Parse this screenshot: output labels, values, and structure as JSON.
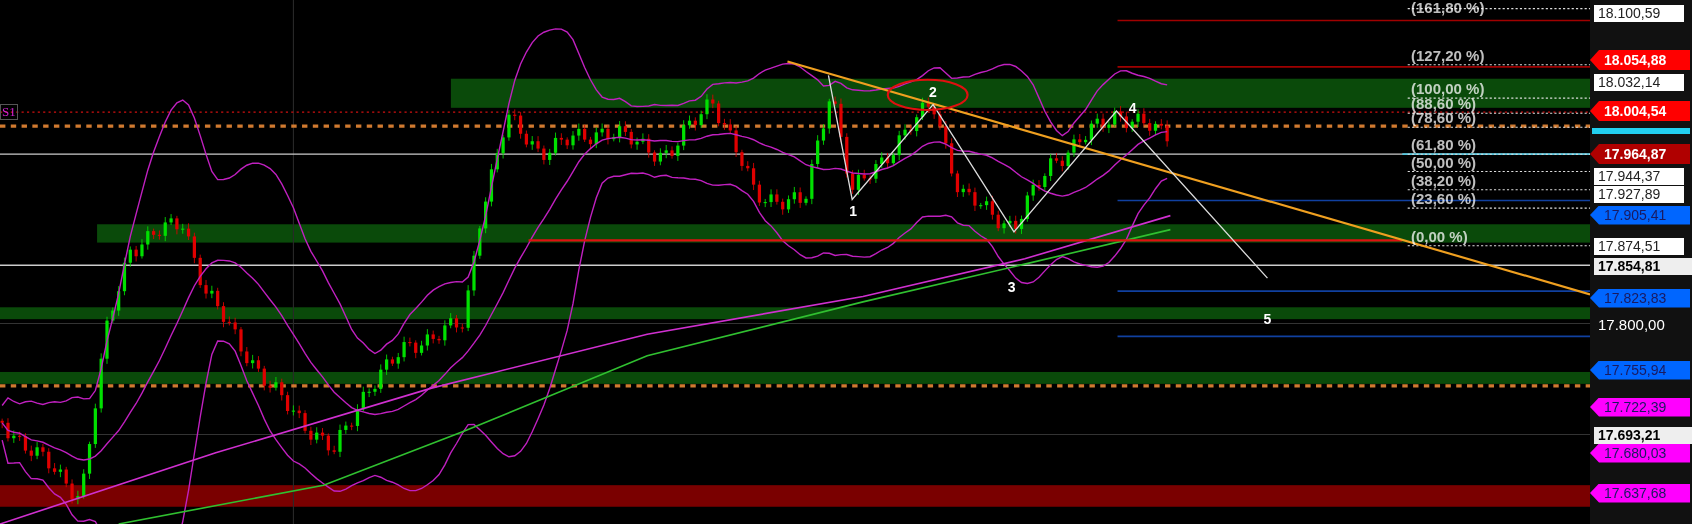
{
  "indicator_label": {
    "text": "S1"
  },
  "fib_levels": [
    {
      "label": "(161,80 %)"
    },
    {
      "label": "(127,20 %)"
    },
    {
      "label": "(100,00 %)"
    },
    {
      "label": "(88,60 %)"
    },
    {
      "label": "(78,60 %)"
    },
    {
      "label": "(61,80 %)"
    },
    {
      "label": "(50,00 %)"
    },
    {
      "label": "(38,20 %)"
    },
    {
      "label": "(23,60 %)"
    },
    {
      "label": "(0,00 %)"
    }
  ],
  "wave_labels": [
    "1",
    "2",
    "3",
    "4",
    "5"
  ],
  "price_tags": [
    {
      "text": "18.100,59",
      "kind": "plain"
    },
    {
      "text": "18.054,88",
      "kind": "flag-strong",
      "color": "#ff0000"
    },
    {
      "text": "18.032,14",
      "kind": "plain"
    },
    {
      "text": "18.004,54",
      "kind": "flag-strong",
      "color": "#ff0000"
    },
    {
      "text": "17.964,87",
      "kind": "flag-strong",
      "color": "#b00000"
    },
    {
      "text": "17.944,37",
      "kind": "plain"
    },
    {
      "text": "17.927,89",
      "kind": "plain"
    },
    {
      "text": "17.905,41",
      "kind": "flag",
      "color": "#0066ff"
    },
    {
      "text": "17.874,51",
      "kind": "plain"
    },
    {
      "text": "17.854,81",
      "kind": "plain-strong"
    },
    {
      "text": "17.823,83",
      "kind": "flag",
      "color": "#0066ff"
    },
    {
      "text": "17.800,00",
      "kind": "label"
    },
    {
      "text": "17.755,94",
      "kind": "flag",
      "color": "#0066ff"
    },
    {
      "text": "17.722,39",
      "kind": "flag",
      "color": "#ff00ff"
    },
    {
      "text": "17.693,21",
      "kind": "plain-strong"
    },
    {
      "text": "17.680,03",
      "kind": "flag",
      "color": "#ff00ff"
    },
    {
      "text": "17.637,68",
      "kind": "flag",
      "color": "#ff00ff"
    }
  ]
}
